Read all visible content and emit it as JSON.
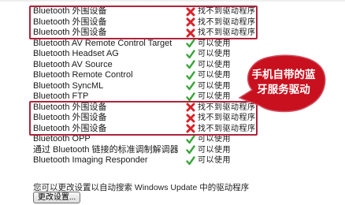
{
  "devices": [
    {
      "name": "Bluetooth 外围设备",
      "status": "找不到驱动程序",
      "state": "error"
    },
    {
      "name": "Bluetooth 外围设备",
      "status": "找不到驱动程序",
      "state": "error"
    },
    {
      "name": "Bluetooth 外围设备",
      "status": "找不到驱动程序",
      "state": "error"
    },
    {
      "name": "Bluetooth AV Remote Control Target",
      "status": "可以使用",
      "state": "ok"
    },
    {
      "name": "Bluetooth Headset AG",
      "status": "可以使用",
      "state": "ok"
    },
    {
      "name": "Bluetooth AV Source",
      "status": "可以使用",
      "state": "ok"
    },
    {
      "name": "Bluetooth Remote Control",
      "status": "可以使用",
      "state": "ok"
    },
    {
      "name": "Bluetooth SyncML",
      "status": "可以使用",
      "state": "ok"
    },
    {
      "name": "Bluetooth FTP",
      "status": "可以使用",
      "state": "ok"
    },
    {
      "name": "Bluetooth 外围设备",
      "status": "找不到驱动程序",
      "state": "error"
    },
    {
      "name": "Bluetooth 外围设备",
      "status": "找不到驱动程序",
      "state": "error"
    },
    {
      "name": "Bluetooth 外围设备",
      "status": "找不到驱动程序",
      "state": "error"
    },
    {
      "name": "Bluetooth OPP",
      "status": "可以使用",
      "state": "ok"
    },
    {
      "name": "通过 Bluetooth 链接的标准调制解调器",
      "status": "可以使用",
      "state": "ok"
    },
    {
      "name": "Bluetooth Imaging Responder",
      "status": "可以使用",
      "state": "ok"
    }
  ],
  "annotation": {
    "text": "手机自带的蓝牙服务驱动",
    "color": "#c8101e"
  },
  "footer": {
    "info": "您可以更改设置以自动搜索 Windows Update 中的驱动程序",
    "button_label": "更改设置..."
  },
  "icons": {
    "ok": "green-check-icon",
    "error": "red-x-icon"
  }
}
